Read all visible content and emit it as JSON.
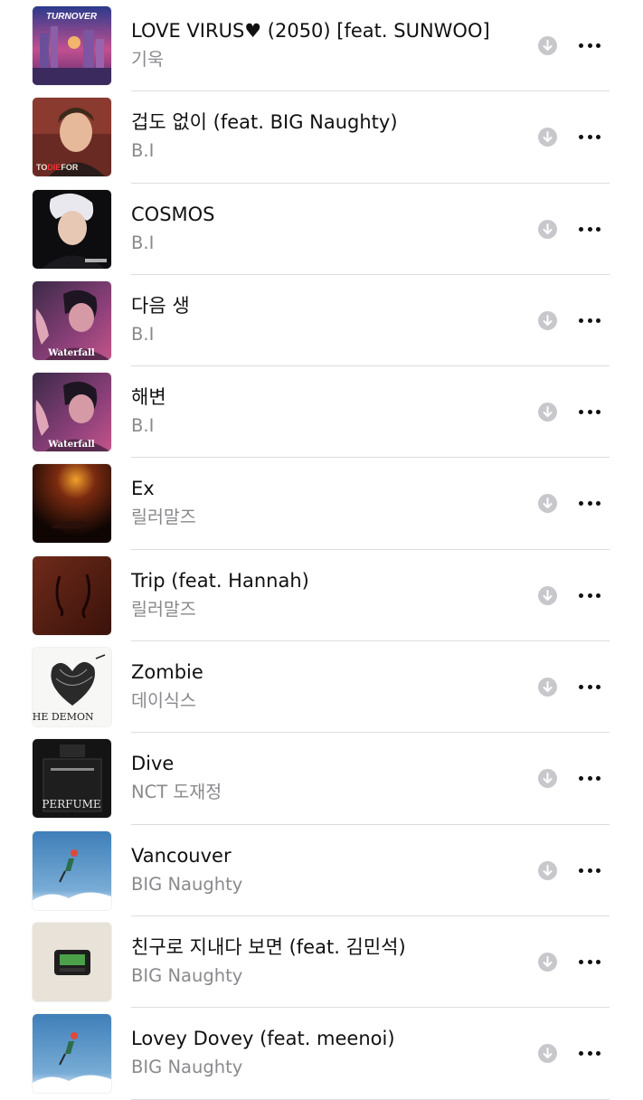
{
  "songs": [
    {
      "title": "LOVE VIRUS♥ (2050) [feat. SUNWOO]",
      "artist": "기욱",
      "art": "loveVirus",
      "art_text": "TURNOVER"
    },
    {
      "title": "겁도 없이 (feat. BIG Naughty)",
      "artist": "B.I",
      "art": "toDieFor",
      "art_text": "TO DIE FOR"
    },
    {
      "title": "COSMOS",
      "artist": "B.I",
      "art": "cosmos",
      "art_text": "COSMOS"
    },
    {
      "title": "다음 생",
      "artist": "B.I",
      "art": "waterfall",
      "art_text": "Waterfall"
    },
    {
      "title": "해변",
      "artist": "B.I",
      "art": "waterfall",
      "art_text": "Waterfall"
    },
    {
      "title": "Ex",
      "artist": "릴러말즈",
      "art": "ex",
      "art_text": ""
    },
    {
      "title": "Trip (feat. Hannah)",
      "artist": "릴러말즈",
      "art": "trip",
      "art_text": ""
    },
    {
      "title": "Zombie",
      "artist": "데이식스",
      "art": "demon",
      "art_text": "THE DEMON"
    },
    {
      "title": "Dive",
      "artist": "NCT 도재정",
      "art": "perfume",
      "art_text": "PERFUME"
    },
    {
      "title": "Vancouver",
      "artist": "BIG Naughty",
      "art": "vancouver",
      "art_text": ""
    },
    {
      "title": "친구로 지내다 보면 (feat. 김민석)",
      "artist": "BIG Naughty",
      "art": "pager",
      "art_text": ""
    },
    {
      "title": "Lovey Dovey (feat. meenoi)",
      "artist": "BIG Naughty",
      "art": "vancouver",
      "art_text": ""
    }
  ],
  "icons": {
    "download": "arrow-down-circle-icon",
    "more": "ellipsis-icon"
  },
  "colors": {
    "title_text": "#111111",
    "artist_text": "#8a8a8e",
    "download_circle": "#c7c7cc",
    "separator": "#dddde1"
  }
}
